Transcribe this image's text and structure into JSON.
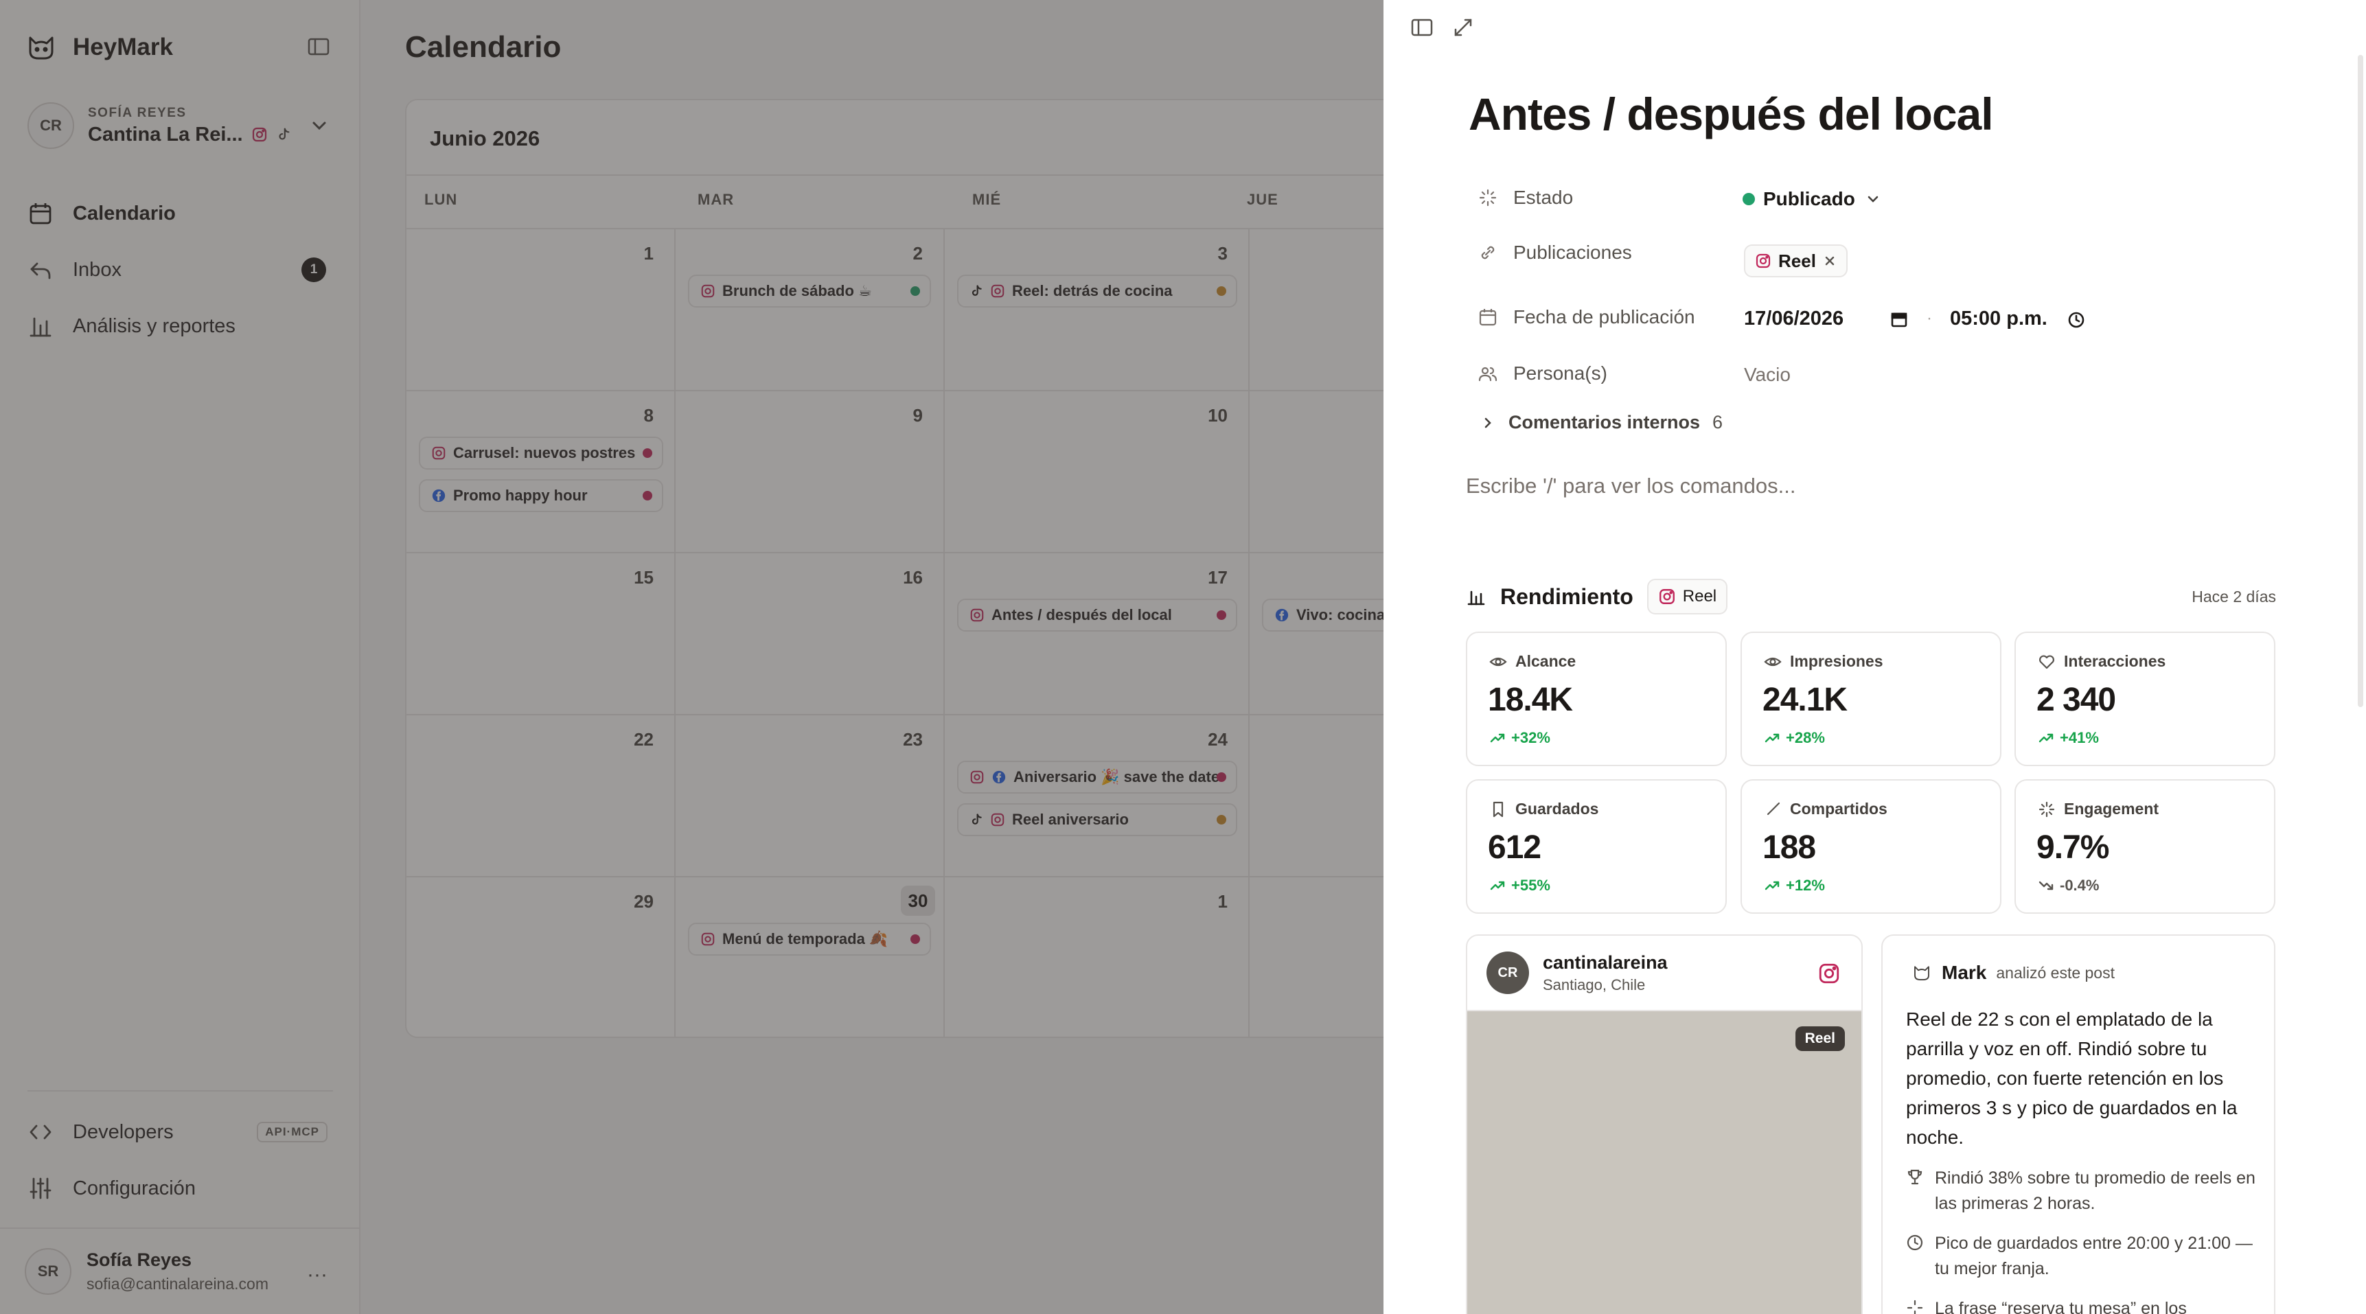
{
  "sidebar": {
    "brand": "HeyMark",
    "account": {
      "initials": "CR",
      "user_label": "SOFÍA REYES",
      "name": "Cantina La Rei..."
    },
    "nav": [
      {
        "label": "Calendario"
      },
      {
        "label": "Inbox",
        "badge": "1"
      },
      {
        "label": "Análisis y reportes"
      }
    ],
    "bottom": [
      {
        "label": "Developers",
        "tag": "API·MCP"
      },
      {
        "label": "Configuración"
      }
    ],
    "user": {
      "initials": "SR",
      "name": "Sofía Reyes",
      "email": "sofia@cantinalareina.com"
    }
  },
  "calendar": {
    "title": "Calendario",
    "month": "Junio 2026",
    "weekdays": [
      "LUN",
      "MAR",
      "MIÉ",
      "JUE"
    ],
    "weeks": [
      [
        "1",
        "2",
        "3"
      ],
      [
        "8",
        "9",
        "10"
      ],
      [
        "15",
        "16",
        "17"
      ],
      [
        "22",
        "23",
        "24"
      ],
      [
        "29",
        "30",
        "1"
      ]
    ],
    "events": [
      {
        "label": "Brunch de sábado ☕",
        "color": "#22a06b"
      },
      {
        "label": "Reel: detrás de cocina",
        "color": "#c98b2b"
      },
      {
        "label": "Carrusel: nuevos postres",
        "color": "#c0265a"
      },
      {
        "label": "Promo happy hour",
        "color": "#c0265a"
      },
      {
        "label": "Antes / después del local",
        "color": "#c0265a"
      },
      {
        "label": "Vivo: cocina",
        "color": ""
      },
      {
        "label": "Aniversario 🎉 save the date",
        "color": "#c0265a"
      },
      {
        "label": "Reel aniversario",
        "color": "#c98b2b"
      },
      {
        "label": "Menú de temporada 🍂",
        "color": "#c0265a"
      }
    ]
  },
  "detail": {
    "title": "Antes / después del local",
    "props": {
      "estado_label": "Estado",
      "estado_value": "Publicado",
      "publicaciones_label": "Publicaciones",
      "publicaciones_value": "Reel",
      "fecha_label": "Fecha de publicación",
      "fecha_value": "17/06/2026",
      "hora_value": "05:00 p.m.",
      "personas_label": "Persona(s)",
      "personas_value": "Vacio"
    },
    "comments_label": "Comentarios internos",
    "comments_count": "6",
    "editor_placeholder": "Escribe '/' para ver los comandos...",
    "performance": {
      "title": "Rendimiento",
      "format": "Reel",
      "ago": "Hace 2 días",
      "metrics": [
        {
          "label": "Alcance",
          "value": "18.4K",
          "delta": "+32%",
          "icon": "eye-icon"
        },
        {
          "label": "Impresiones",
          "value": "24.1K",
          "delta": "+28%",
          "icon": "eye-icon"
        },
        {
          "label": "Interacciones",
          "value": "2 340",
          "delta": "+41%",
          "icon": "heart-icon"
        },
        {
          "label": "Guardados",
          "value": "612",
          "delta": "+55%",
          "icon": "bookmark-icon"
        },
        {
          "label": "Compartidos",
          "value": "188",
          "delta": "+12%",
          "icon": "send-icon"
        },
        {
          "label": "Engagement",
          "value": "9.7%",
          "delta": "-0.4%",
          "icon": "sparkle-icon"
        }
      ]
    },
    "post": {
      "initials": "CR",
      "handle": "cantinalareina",
      "location": "Santiago, Chile",
      "tag": "Reel"
    },
    "ai": {
      "name": "Mark",
      "sub": "analizó este post",
      "summary": "Reel de 22 s con el emplatado de la parrilla y voz en off. Rindió sobre tu promedio, con fuerte retención en los primeros 3 s y pico de guardados en la noche.",
      "bullets": [
        "Rindió 38% sobre tu promedio de reels en las primeras 2 horas.",
        "Pico de guardados entre 20:00 y 21:00 — tu mejor franja.",
        "La frase “reserva tu mesa” en los"
      ]
    }
  }
}
